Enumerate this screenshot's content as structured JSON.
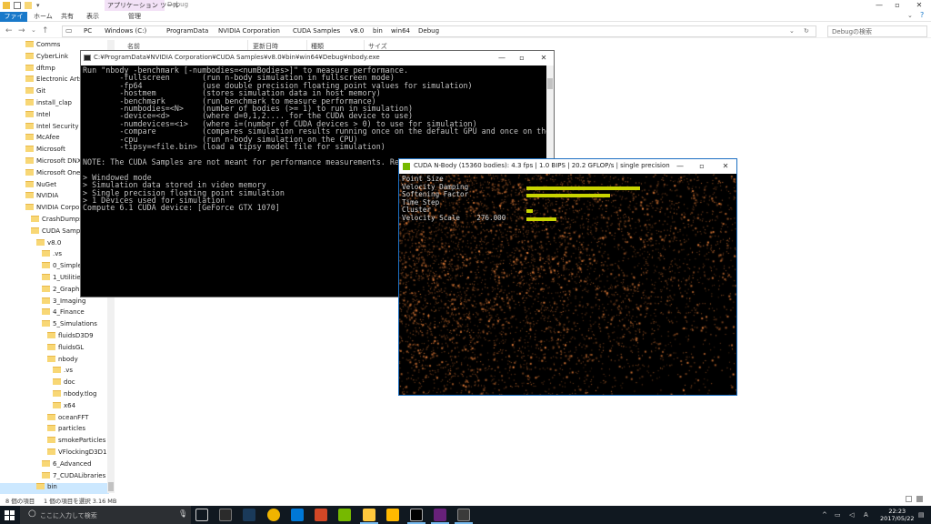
{
  "explorer": {
    "context_tab_group": "アプリケーション ツール",
    "window_title": "Debug",
    "ribbon_tabs": [
      "ファイル",
      "ホーム",
      "共有",
      "表示",
      "管理"
    ],
    "breadcrumb": [
      "PC",
      "Windows (C:)",
      "ProgramData",
      "NVIDIA Corporation",
      "CUDA Samples",
      "v8.0",
      "bin",
      "win64",
      "Debug"
    ],
    "search_placeholder": "Debugの検索",
    "columns": [
      "名前",
      "更新日時",
      "種類",
      "サイズ"
    ],
    "tree": [
      "Comms",
      "CyberLink",
      "dftmp",
      "Electronic Arts",
      "Git",
      "install_clap",
      "Intel",
      "Intel Security",
      "McAfee",
      "Microsoft",
      "Microsoft DNX",
      "Microsoft OneD",
      "NuGet",
      "NVIDIA",
      "NVIDIA Corpora",
      "CrashDumps",
      "CUDA Sample",
      "v8.0",
      ".vs",
      "0_Simple",
      "1_Utilities",
      "2_Graphics",
      "3_Imaging",
      "4_Finance",
      "5_Simulations",
      "fluidsD3D9",
      "fluidsGL",
      "nbody",
      ".vs",
      "doc",
      "nbody.tlog",
      "x64",
      "oceanFFT",
      "particles",
      "smokeParticles",
      "VFlockingD3D10",
      "6_Advanced",
      "7_CUDALibraries",
      "bin"
    ],
    "status_items": "8 個の項目",
    "status_selected": "1 個の項目を選択  3.16 MB"
  },
  "console": {
    "title": "C:¥ProgramData¥NVIDIA Corporation¥CUDA Samples¥v8.0¥bin¥win64¥Debug¥nbody.exe",
    "lines": [
      "Run \"nbody -benchmark [-numbodies=<numBodies>]\" to measure performance.",
      "        -fullscreen       (run n-body simulation in fullscreen mode)",
      "        -fp64             (use double precision floating point values for simulation)",
      "        -hostmem          (stores simulation data in host memory)",
      "        -benchmark        (run benchmark to measure performance)",
      "        -numbodies=<N>    (number of bodies (>= 1) to run in simulation)",
      "        -device=<d>       (where d=0,1,2.... for the CUDA device to use)",
      "        -numdevices=<i>   (where i=(number of CUDA devices > 0) to use for simulation)",
      "        -compare          (compares simulation results running once on the default GPU and once on the CPU)",
      "        -cpu              (run n-body simulation on the CPU)",
      "        -tipsy=<file.bin> (load a tipsy model file for simulation)",
      "",
      "NOTE: The CUDA Samples are not meant for performance measurements. Results may vary when GPU Boost is enabled.",
      "",
      "> Windowed mode",
      "> Simulation data stored in video memory",
      "> Single precision floating point simulation",
      "> 1 Devices used for simulation",
      "Compute 6.1 CUDA device: [GeForce GTX 1070]"
    ]
  },
  "nbody": {
    "title": "CUDA N-Body (15360 bodies): 4.3 fps | 1.0 BIPS | 20.2 GFLOP/s | single precision",
    "params": [
      {
        "label": "Point Size",
        "value": "",
        "level": 0.0
      },
      {
        "label": "Velocity Damping",
        "value": "",
        "level": 0.95
      },
      {
        "label": "Softening Factor",
        "value": "",
        "level": 0.7
      },
      {
        "label": "Time Step",
        "value": "",
        "level": 0.0
      },
      {
        "label": "Cluster",
        "value": "",
        "level": 0.05
      },
      {
        "label": "Velocity Scale",
        "value": "276.000",
        "level": 0.25
      }
    ]
  },
  "taskbar": {
    "search_placeholder": "ここに入力して検索",
    "time": "22:23",
    "date": "2017/05/22",
    "ime": "A"
  }
}
